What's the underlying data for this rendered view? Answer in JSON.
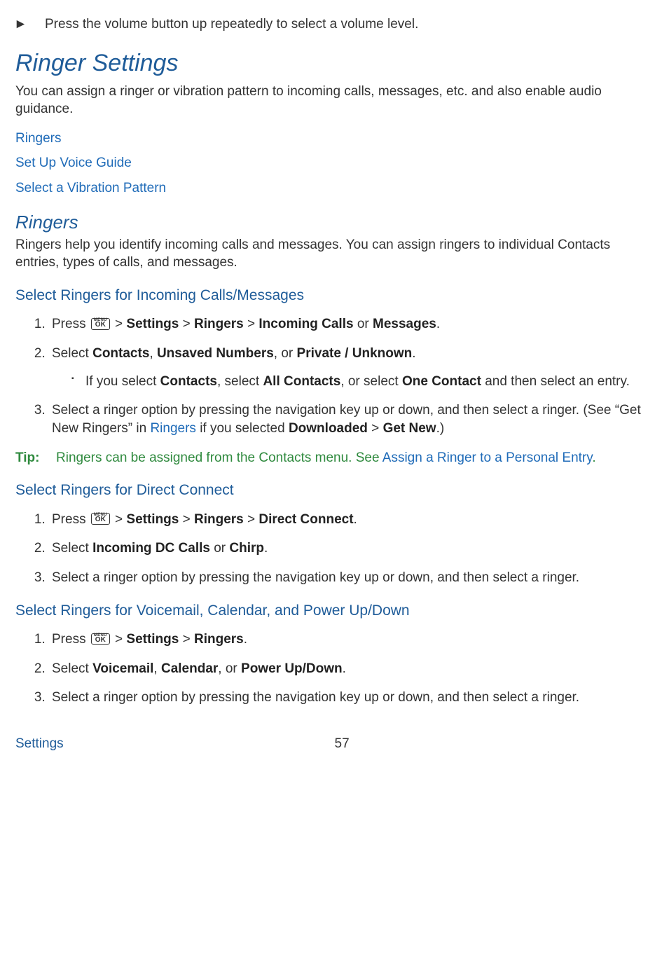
{
  "topInstruction": "Press the volume button up repeatedly to select a volume level.",
  "h1": "Ringer Settings",
  "h1_desc": "You can assign a ringer or vibration pattern to incoming calls, messages, etc. and also enable audio guidance.",
  "toc": {
    "ringers": "Ringers",
    "voice": "Set Up Voice Guide",
    "vibration": "Select a Vibration Pattern"
  },
  "h2_ringers": "Ringers",
  "h2_ringers_desc": "Ringers help you identify incoming calls and messages. You can assign ringers to individual Contacts entries, types of calls, and messages.",
  "section1": {
    "title": "Select Ringers for Incoming Calls/Messages",
    "step1_a": "Press ",
    "step1_b": " > ",
    "step1_settings": "Settings",
    "step1_c": " > ",
    "step1_ringers": "Ringers",
    "step1_d": " > ",
    "step1_incoming": "Incoming Calls",
    "step1_or": " or ",
    "step1_messages": "Messages",
    "step1_dot": ".",
    "step2_a": "Select ",
    "step2_contacts": "Contacts",
    "step2_b": ", ",
    "step2_unsaved": "Unsaved Numbers",
    "step2_c": ", or ",
    "step2_private": "Private / Unknown",
    "step2_dot": ".",
    "step2_sub_a": "If you select ",
    "step2_sub_contacts": "Contacts",
    "step2_sub_b": ", select ",
    "step2_sub_all": "All Contacts",
    "step2_sub_c": ", or select ",
    "step2_sub_one": "One Contact",
    "step2_sub_d": " and then select an entry.",
    "step3_a": "Select a ringer option by pressing the navigation key up or down, and then select a ringer. (See “Get New Ringers” in ",
    "step3_link": "Ringers",
    "step3_b": " if you selected ",
    "step3_downloaded": "Downloaded",
    "step3_c": " > ",
    "step3_getnew": "Get New",
    "step3_d": ".)"
  },
  "tip": {
    "label": "Tip:",
    "body_a": "Ringers can be assigned from the Contacts menu. See ",
    "body_link": "Assign a Ringer to a Personal Entry",
    "body_b": "."
  },
  "section2": {
    "title": "Select Ringers for Direct Connect",
    "step1_a": "Press ",
    "step1_b": " > ",
    "step1_settings": "Settings",
    "step1_c": " > ",
    "step1_ringers": "Ringers",
    "step1_d": " > ",
    "step1_dc": "Direct Connect",
    "step1_dot": ".",
    "step2_a": "Select ",
    "step2_dc": "Incoming DC Calls",
    "step2_or": " or ",
    "step2_chirp": "Chirp",
    "step2_dot": ".",
    "step3": "Select a ringer option by pressing the navigation key up or down, and then select a ringer."
  },
  "section3": {
    "title": "Select Ringers for Voicemail, Calendar, and Power Up/Down",
    "step1_a": "Press ",
    "step1_b": " > ",
    "step1_settings": "Settings",
    "step1_c": " > ",
    "step1_ringers": "Ringers",
    "step1_dot": ".",
    "step2_a": "Select ",
    "step2_vm": "Voicemail",
    "step2_b": ", ",
    "step2_cal": "Calendar",
    "step2_c": ", or ",
    "step2_power": "Power Up/Down",
    "step2_dot": ".",
    "step3": "Select a ringer option by pressing the navigation key up or down, and then select a ringer."
  },
  "footer": {
    "section": "Settings",
    "page": "57"
  },
  "key": {
    "menu": "MENU",
    "ok": "OK"
  }
}
